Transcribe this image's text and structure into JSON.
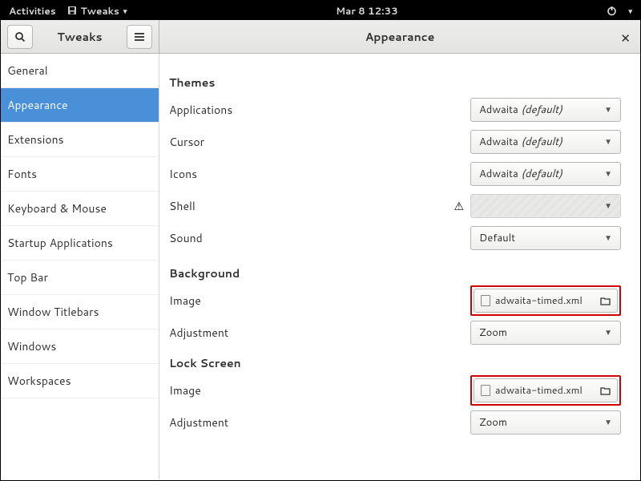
{
  "topbar": {
    "activities": "Activities",
    "app_name": "Tweaks",
    "clock": "Mar 8  12:33"
  },
  "header": {
    "left_title": "Tweaks",
    "right_title": "Appearance"
  },
  "sidebar": {
    "items": [
      {
        "label": "General",
        "active": false
      },
      {
        "label": "Appearance",
        "active": true
      },
      {
        "label": "Extensions",
        "active": false
      },
      {
        "label": "Fonts",
        "active": false
      },
      {
        "label": "Keyboard & Mouse",
        "active": false
      },
      {
        "label": "Startup Applications",
        "active": false
      },
      {
        "label": "Top Bar",
        "active": false
      },
      {
        "label": "Window Titlebars",
        "active": false
      },
      {
        "label": "Windows",
        "active": false
      },
      {
        "label": "Workspaces",
        "active": false
      }
    ]
  },
  "content": {
    "themes": {
      "title": "Themes",
      "applications": {
        "label": "Applications",
        "value": "Adwaita",
        "suffix": "(default)"
      },
      "cursor": {
        "label": "Cursor",
        "value": "Adwaita",
        "suffix": "(default)"
      },
      "icons": {
        "label": "Icons",
        "value": "Adwaita",
        "suffix": "(default)"
      },
      "shell": {
        "label": "Shell",
        "value": ""
      },
      "sound": {
        "label": "Sound",
        "value": "Default"
      }
    },
    "background": {
      "title": "Background",
      "image": {
        "label": "Image",
        "value": "adwaita-timed.xml"
      },
      "adjustment": {
        "label": "Adjustment",
        "value": "Zoom"
      }
    },
    "lockscreen": {
      "title": "Lock Screen",
      "image": {
        "label": "Image",
        "value": "adwaita-timed.xml"
      },
      "adjustment": {
        "label": "Adjustment",
        "value": "Zoom"
      }
    }
  }
}
